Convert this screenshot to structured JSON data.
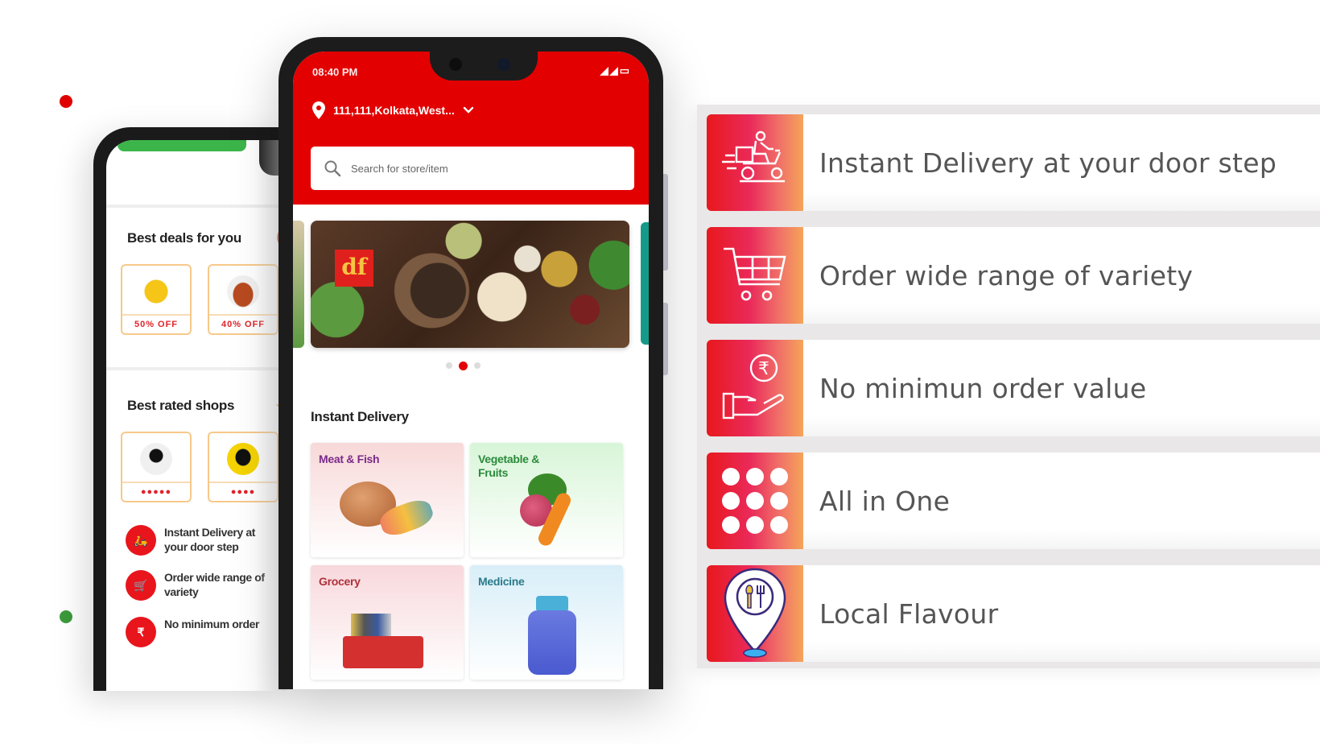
{
  "back_phone": {
    "deals_title": "Best deals for you",
    "deals": [
      {
        "discount": "50% OFF",
        "logo": "mascot-logo"
      },
      {
        "discount": "40% OFF",
        "logo": "food-logo"
      }
    ],
    "rated_title": "Best rated shops",
    "rated": [
      {
        "stars": "●●●●●",
        "logo": "bowl-logo"
      },
      {
        "stars": "●●●●",
        "logo": "yellow-bowl-logo"
      }
    ],
    "features": [
      {
        "icon": "delivery-icon",
        "glyph": "🛵",
        "text": "Instant Delivery at your door step"
      },
      {
        "icon": "cart-icon",
        "glyph": "🛒",
        "text": "Order wide range of variety"
      },
      {
        "icon": "rupee-hand-icon",
        "glyph": "₹",
        "text": "No minimum order"
      }
    ]
  },
  "front_phone": {
    "status_time": "08:40 PM",
    "status_icons": "◢◢▭",
    "location": "111,111,Kolkata,West...",
    "search_placeholder": "Search for store/item",
    "banner_brand": "df",
    "carousel": {
      "count": 3,
      "active": 1
    },
    "section_title": "Instant Delivery",
    "categories": [
      {
        "label": "Meat & Fish",
        "color": "#7a2a8a"
      },
      {
        "label": "Vegetable & Fruits",
        "color": "#2a8a3a"
      },
      {
        "label": "Grocery",
        "color": "#b0303a"
      },
      {
        "label": "Medicine",
        "color": "#2a7a8a"
      }
    ]
  },
  "features": [
    {
      "icon": "delivery-scooter-icon",
      "label": "Instant Delivery at your door step"
    },
    {
      "icon": "shopping-cart-icon",
      "label": "Order wide range of variety"
    },
    {
      "icon": "rupee-hand-icon",
      "label": "No minimun order value"
    },
    {
      "icon": "grid-dots-icon",
      "label": "All in One"
    },
    {
      "icon": "location-food-pin-icon",
      "label": "Local Flavour"
    }
  ],
  "colors": {
    "brand_red": "#e30000",
    "accent_gradient_start": "#e8181c",
    "accent_gradient_end": "#f5a45a",
    "feature_text": "#555555"
  }
}
